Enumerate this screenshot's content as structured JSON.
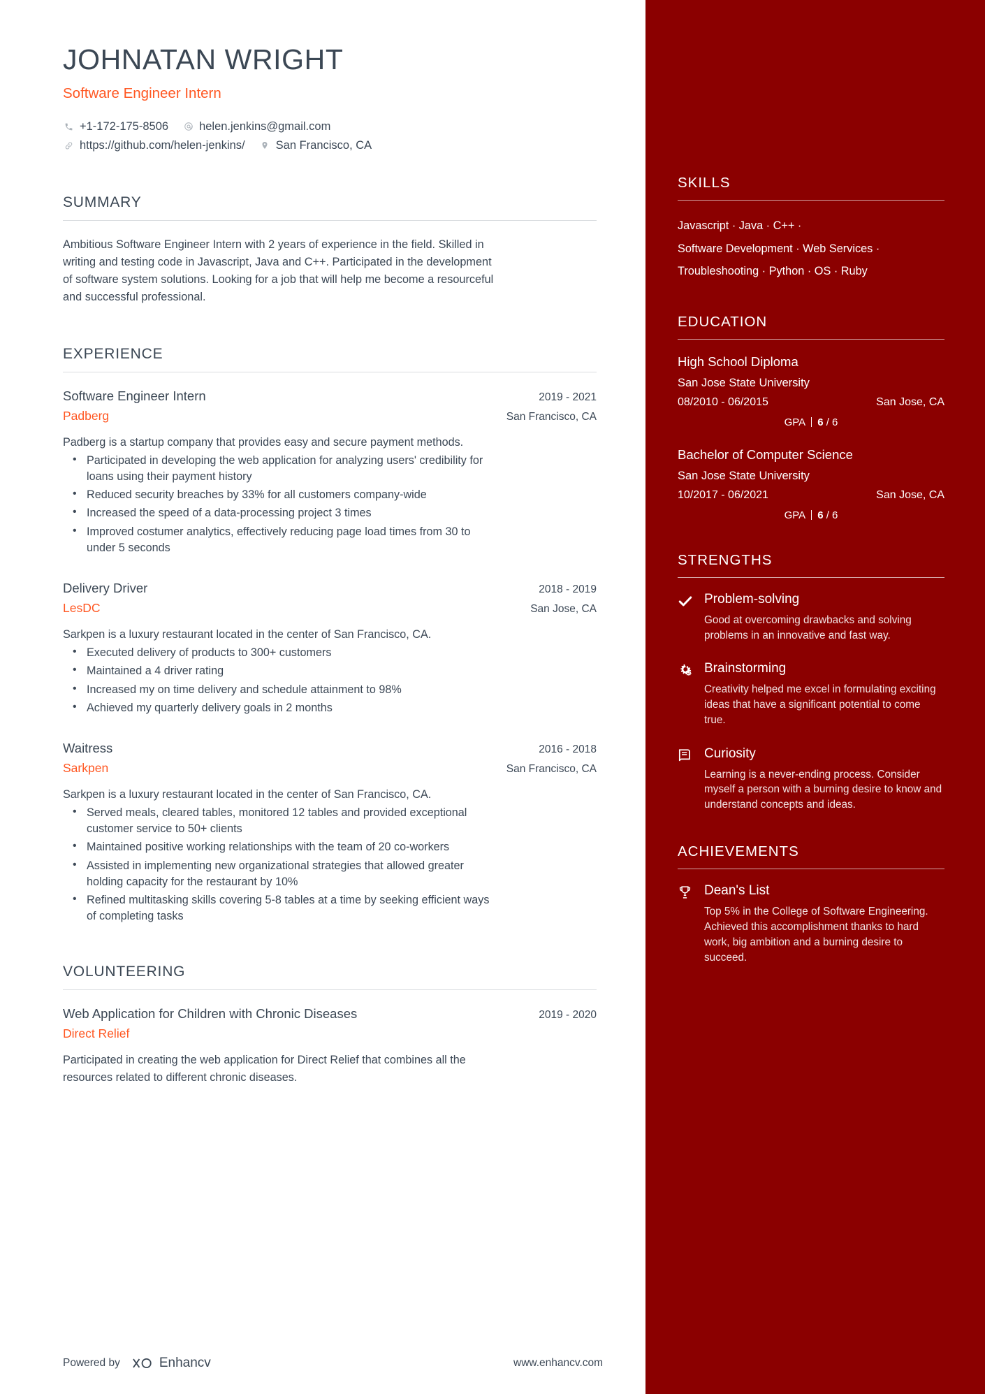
{
  "header": {
    "name": "JOHNATAN WRIGHT",
    "title": "Software Engineer Intern",
    "phone": "+1-172-175-8506",
    "email": "helen.jenkins@gmail.com",
    "website": "https://github.com/helen-jenkins/",
    "location": "San Francisco, CA"
  },
  "summary": {
    "heading": "SUMMARY",
    "text": "Ambitious Software Engineer Intern with 2 years of experience in the field. Skilled in writing and testing code in Javascript, Java and C++. Participated in the development of software system solutions. Looking for a job that will help me become a resourceful and successful professional."
  },
  "experience": {
    "heading": "EXPERIENCE",
    "entries": [
      {
        "role": "Software Engineer Intern",
        "date": "2019 - 2021",
        "company": "Padberg",
        "location": "San Francisco, CA",
        "description": "Padberg is a startup company that provides easy and secure payment methods.",
        "bullets": [
          "Participated in developing the web application for analyzing users' credibility for loans using their payment history",
          "Reduced security breaches by 33% for all customers company-wide",
          "Increased the speed of a data-processing project 3 times",
          "Improved costumer analytics, effectively reducing page load times from 30 to under 5 seconds"
        ]
      },
      {
        "role": "Delivery Driver",
        "date": "2018 - 2019",
        "company": "LesDC",
        "location": "San Jose, CA",
        "description": "Sarkpen is a luxury restaurant located in the center of San Francisco, CA.",
        "bullets": [
          "Executed delivery of products to 300+ customers",
          "Maintained a 4 driver rating",
          "Increased my on time delivery and schedule attainment to 98%",
          "Achieved my quarterly delivery goals in 2 months"
        ]
      },
      {
        "role": "Waitress",
        "date": "2016 - 2018",
        "company": "Sarkpen",
        "location": "San Francisco, CA",
        "description": "Sarkpen is a luxury restaurant located in the center of San Francisco, CA.",
        "bullets": [
          "Served meals, cleared tables, monitored 12 tables and provided exceptional customer service to 50+ clients",
          "Maintained positive working relationships with the team of 20 co-workers",
          "Assisted in implementing new organizational strategies that allowed greater holding capacity for the restaurant by 10%",
          "Refined multitasking skills covering 5-8 tables at a time by seeking efficient ways of completing tasks"
        ]
      }
    ]
  },
  "volunteering": {
    "heading": "VOLUNTEERING",
    "entries": [
      {
        "role": "Web Application for Children with Chronic Diseases",
        "date": "2019 - 2020",
        "company": "Direct Relief",
        "location": "",
        "description": "Participated in creating the web application for Direct Relief that combines all the resources related to different chronic diseases.",
        "bullets": []
      }
    ]
  },
  "skills": {
    "heading": "SKILLS",
    "lines": [
      "Javascript · Java · C++ ·",
      " Software Development · Web Services ·",
      "Troubleshooting · Python ·  OS  · Ruby"
    ]
  },
  "education": {
    "heading": "EDUCATION",
    "entries": [
      {
        "degree": "High School Diploma",
        "school": "San Jose State University",
        "dates": "08/2010 - 06/2015",
        "location": "San Jose, CA",
        "gpa_label": "GPA",
        "gpa_value": "6",
        "gpa_max": "/ 6"
      },
      {
        "degree": "Bachelor of Computer Science",
        "school": "San Jose State University",
        "dates": "10/2017 - 06/2021",
        "location": "San Jose, CA",
        "gpa_label": "GPA",
        "gpa_value": "6",
        "gpa_max": "/ 6"
      }
    ]
  },
  "strengths": {
    "heading": "STRENGTHS",
    "items": [
      {
        "icon": "check-icon",
        "title": "Problem-solving",
        "description": "Good at overcoming drawbacks and solving problems in an innovative and fast way."
      },
      {
        "icon": "gears-icon",
        "title": "Brainstorming",
        "description": "Creativity helped me excel in formulating exciting ideas that have a significant potential to come true."
      },
      {
        "icon": "book-icon",
        "title": "Curiosity",
        "description": "Learning is a never-ending process. Consider myself a person with a burning desire to know and understand concepts and ideas."
      }
    ]
  },
  "achievements": {
    "heading": "ACHIEVEMENTS",
    "items": [
      {
        "icon": "trophy-icon",
        "title": "Dean's List",
        "description": "Top 5% in the College of Software Engineering. Achieved this accomplishment thanks to hard work, big ambition and a burning desire to succeed."
      }
    ]
  },
  "footer": {
    "powered_by": "Powered by",
    "brand": "Enhancv",
    "url": "www.enhancv.com"
  },
  "colors": {
    "accent": "#ff5722",
    "sidebar": "#8b0000",
    "text": "#3c4856"
  }
}
